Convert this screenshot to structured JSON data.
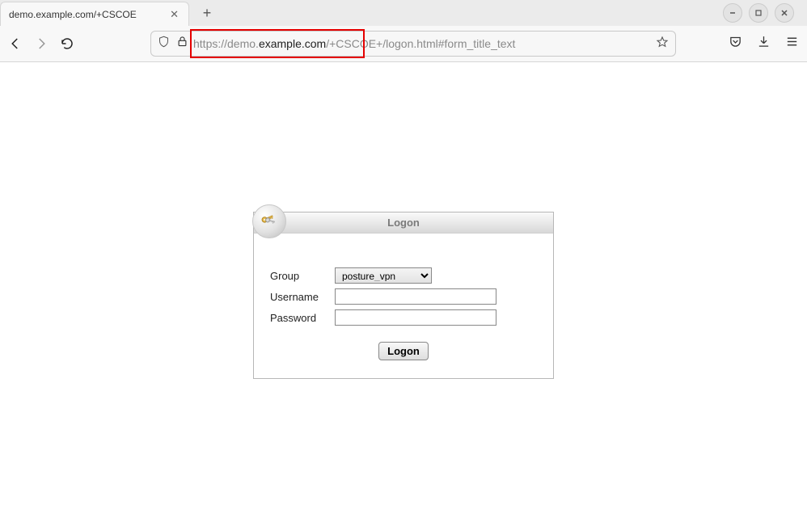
{
  "browser": {
    "tab_title": "demo.example.com/+CSCOE",
    "url_prefix": "https://demo.",
    "url_domain": "example.com",
    "url_suffix": "/+CSCOE+/logon.html#form_title_text"
  },
  "login": {
    "header": "Logon",
    "group_label": "Group",
    "group_value": "posture_vpn",
    "username_label": "Username",
    "username_value": "",
    "password_label": "Password",
    "password_value": "",
    "submit_label": "Logon"
  },
  "icons": {
    "badge": "keys-icon"
  }
}
